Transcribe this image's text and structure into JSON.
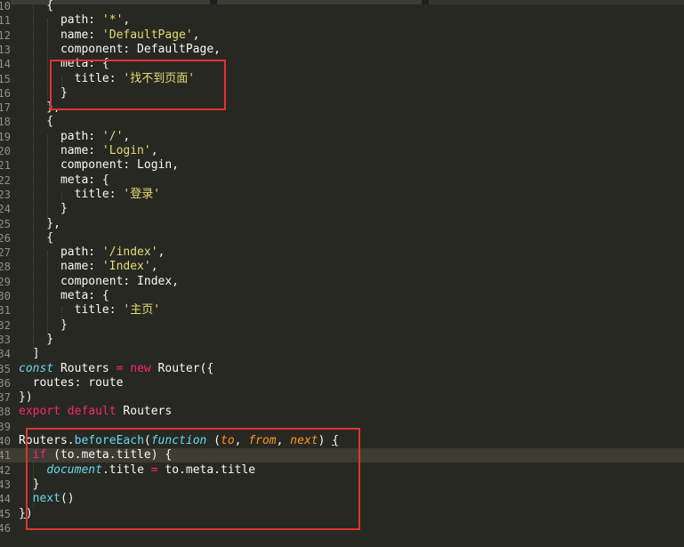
{
  "editor": {
    "lines": [
      {
        "n": "10",
        "segments": [
          {
            "t": "    {",
            "c": "p"
          }
        ]
      },
      {
        "n": "11",
        "segments": [
          {
            "t": "      path: ",
            "c": "p"
          },
          {
            "t": "'*'",
            "c": "s"
          },
          {
            "t": ",",
            "c": "p"
          }
        ]
      },
      {
        "n": "12",
        "segments": [
          {
            "t": "      name: ",
            "c": "p"
          },
          {
            "t": "'DefaultPage'",
            "c": "s"
          },
          {
            "t": ",",
            "c": "p"
          }
        ]
      },
      {
        "n": "13",
        "segments": [
          {
            "t": "      component: DefaultPage,",
            "c": "p"
          }
        ]
      },
      {
        "n": "14",
        "segments": [
          {
            "t": "      meta: {",
            "c": "p"
          }
        ]
      },
      {
        "n": "15",
        "segments": [
          {
            "t": "        title: ",
            "c": "p"
          },
          {
            "t": "'找不到页面'",
            "c": "s"
          }
        ]
      },
      {
        "n": "16",
        "segments": [
          {
            "t": "      }",
            "c": "p"
          }
        ]
      },
      {
        "n": "17",
        "segments": [
          {
            "t": "    },",
            "c": "p"
          }
        ]
      },
      {
        "n": "18",
        "segments": [
          {
            "t": "    {",
            "c": "p"
          }
        ]
      },
      {
        "n": "19",
        "segments": [
          {
            "t": "      path: ",
            "c": "p"
          },
          {
            "t": "'/'",
            "c": "s"
          },
          {
            "t": ",",
            "c": "p"
          }
        ]
      },
      {
        "n": "20",
        "segments": [
          {
            "t": "      name: ",
            "c": "p"
          },
          {
            "t": "'Login'",
            "c": "s"
          },
          {
            "t": ",",
            "c": "p"
          }
        ]
      },
      {
        "n": "21",
        "segments": [
          {
            "t": "      component: Login,",
            "c": "p"
          }
        ]
      },
      {
        "n": "22",
        "segments": [
          {
            "t": "      meta: {",
            "c": "p"
          }
        ]
      },
      {
        "n": "23",
        "segments": [
          {
            "t": "        title: ",
            "c": "p"
          },
          {
            "t": "'登录'",
            "c": "s"
          }
        ]
      },
      {
        "n": "24",
        "segments": [
          {
            "t": "      }",
            "c": "p"
          }
        ]
      },
      {
        "n": "25",
        "segments": [
          {
            "t": "    },",
            "c": "p"
          }
        ]
      },
      {
        "n": "26",
        "segments": [
          {
            "t": "    {",
            "c": "p"
          }
        ]
      },
      {
        "n": "27",
        "segments": [
          {
            "t": "      path: ",
            "c": "p"
          },
          {
            "t": "'/index'",
            "c": "s"
          },
          {
            "t": ",",
            "c": "p"
          }
        ]
      },
      {
        "n": "28",
        "segments": [
          {
            "t": "      name: ",
            "c": "p"
          },
          {
            "t": "'Index'",
            "c": "s"
          },
          {
            "t": ",",
            "c": "p"
          }
        ]
      },
      {
        "n": "29",
        "segments": [
          {
            "t": "      component: Index,",
            "c": "p"
          }
        ]
      },
      {
        "n": "30",
        "segments": [
          {
            "t": "      meta: {",
            "c": "p"
          }
        ]
      },
      {
        "n": "31",
        "segments": [
          {
            "t": "        title: ",
            "c": "p"
          },
          {
            "t": "'主页'",
            "c": "s"
          }
        ]
      },
      {
        "n": "32",
        "segments": [
          {
            "t": "      }",
            "c": "p"
          }
        ]
      },
      {
        "n": "33",
        "segments": [
          {
            "t": "    }",
            "c": "p"
          }
        ]
      },
      {
        "n": "34",
        "segments": [
          {
            "t": "  ]",
            "c": "p"
          }
        ]
      },
      {
        "n": "35",
        "segments": [
          {
            "t": "const",
            "c": "i"
          },
          {
            "t": " Routers ",
            "c": "p"
          },
          {
            "t": "=",
            "c": "k"
          },
          {
            "t": " ",
            "c": "p"
          },
          {
            "t": "new",
            "c": "k"
          },
          {
            "t": " Router({",
            "c": "p"
          }
        ]
      },
      {
        "n": "36",
        "segments": [
          {
            "t": "  routes: route",
            "c": "p"
          }
        ]
      },
      {
        "n": "37",
        "segments": [
          {
            "t": "})",
            "c": "p"
          }
        ]
      },
      {
        "n": "38",
        "segments": [
          {
            "t": "export",
            "c": "k"
          },
          {
            "t": " ",
            "c": "p"
          },
          {
            "t": "default",
            "c": "k"
          },
          {
            "t": " Routers",
            "c": "p"
          }
        ]
      },
      {
        "n": "39",
        "segments": [
          {
            "t": "",
            "c": "p"
          }
        ]
      },
      {
        "n": "40",
        "segments": [
          {
            "t": "Routers.",
            "c": "p"
          },
          {
            "t": "beforeEach",
            "c": "f"
          },
          {
            "t": "(",
            "c": "p"
          },
          {
            "t": "function",
            "c": "i"
          },
          {
            "t": " (",
            "c": "p"
          },
          {
            "t": "to",
            "c": "a"
          },
          {
            "t": ", ",
            "c": "p"
          },
          {
            "t": "from",
            "c": "a"
          },
          {
            "t": ", ",
            "c": "p"
          },
          {
            "t": "next",
            "c": "a"
          },
          {
            "t": ") ",
            "c": "p"
          },
          {
            "t": "{",
            "c": "p u"
          }
        ]
      },
      {
        "n": "41",
        "active": true,
        "segments": [
          {
            "t": "  ",
            "c": "p"
          },
          {
            "t": "if",
            "c": "k"
          },
          {
            "t": " (to.meta.title) {",
            "c": "p"
          }
        ]
      },
      {
        "n": "42",
        "segments": [
          {
            "t": "    ",
            "c": "p"
          },
          {
            "t": "document",
            "c": "i"
          },
          {
            "t": ".title ",
            "c": "p"
          },
          {
            "t": "=",
            "c": "k"
          },
          {
            "t": " to.meta.title",
            "c": "p"
          }
        ]
      },
      {
        "n": "43",
        "segments": [
          {
            "t": "  }",
            "c": "p"
          }
        ]
      },
      {
        "n": "44",
        "segments": [
          {
            "t": "  ",
            "c": "p"
          },
          {
            "t": "next",
            "c": "f"
          },
          {
            "t": "()",
            "c": "p"
          }
        ]
      },
      {
        "n": "45",
        "segments": [
          {
            "t": "}",
            "c": "p u"
          },
          {
            "t": ")",
            "c": "p"
          }
        ]
      },
      {
        "n": "46",
        "segments": [
          {
            "t": "",
            "c": "p"
          }
        ]
      }
    ]
  },
  "colors": {
    "background": "#272822",
    "highlight_box": "#e2332f",
    "string": "#e6db74",
    "keyword": "#f92672",
    "storage": "#66d9ef",
    "parameter": "#fd971f",
    "text": "#f8f8f2",
    "line_number": "#8f908a"
  }
}
